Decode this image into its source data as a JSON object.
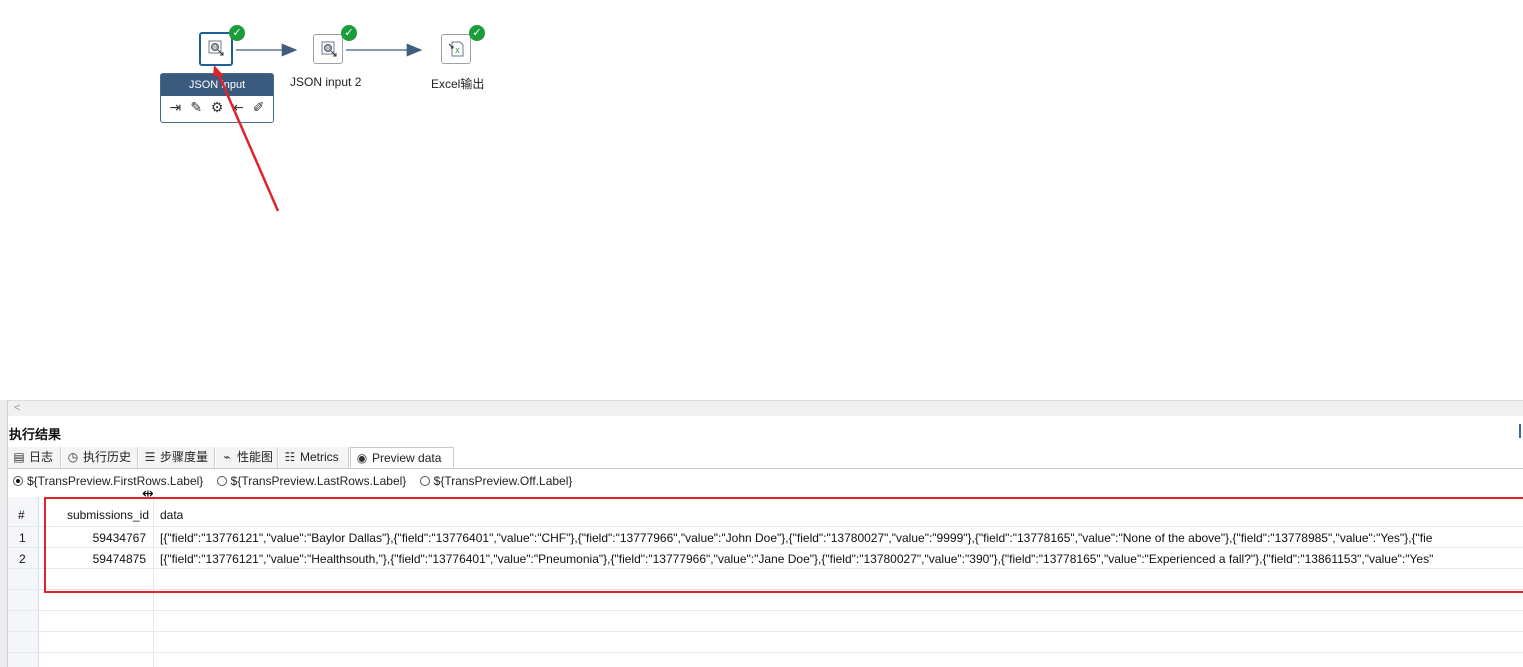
{
  "canvas": {
    "steps": [
      {
        "id": "json-input",
        "label": "JSON input",
        "icon": "json-input-icon",
        "status": "success"
      },
      {
        "id": "json-input-2",
        "label": "JSON input 2",
        "icon": "json-input-icon",
        "status": "success"
      },
      {
        "id": "excel-output",
        "label": "Excel输出",
        "icon": "excel-output-icon",
        "status": "success"
      }
    ],
    "popup": {
      "title": "JSON input",
      "tools": [
        "input-icon",
        "edit-icon",
        "gear-icon",
        "output-icon",
        "pencil-icon"
      ]
    },
    "scroll_left_glyph": "<"
  },
  "results": {
    "title": "执行结果",
    "tabs": [
      {
        "label": "日志",
        "icon": "log-icon"
      },
      {
        "label": "执行历史",
        "icon": "history-icon"
      },
      {
        "label": "步骤度量",
        "icon": "step-metrics-icon"
      },
      {
        "label": "性能图",
        "icon": "performance-chart-icon"
      },
      {
        "label": "Metrics",
        "icon": "metrics-icon"
      },
      {
        "label": "Preview data",
        "icon": "eye-icon",
        "active": true
      }
    ],
    "radios": [
      {
        "label": "${TransPreview.FirstRows.Label}",
        "checked": true
      },
      {
        "label": "${TransPreview.LastRows.Label}",
        "checked": false
      },
      {
        "label": "${TransPreview.Off.Label}",
        "checked": false
      }
    ],
    "table": {
      "headers": [
        "#",
        "submissions_id",
        "data"
      ],
      "rows": [
        [
          "1",
          "59434767",
          "[{\"field\":\"13776121\",\"value\":\"Baylor Dallas\"},{\"field\":\"13776401\",\"value\":\"CHF\"},{\"field\":\"13777966\",\"value\":\"John Doe\"},{\"field\":\"13780027\",\"value\":\"9999\"},{\"field\":\"13778165\",\"value\":\"None of the above\"},{\"field\":\"13778985\",\"value\":\"Yes\"},{\"fie"
        ],
        [
          "2",
          "59474875",
          "[{\"field\":\"13776121\",\"value\":\"Healthsouth,\"},{\"field\":\"13776401\",\"value\":\"Pneumonia\"},{\"field\":\"13777966\",\"value\":\"Jane Doe\"},{\"field\":\"13780027\",\"value\":\"390\"},{\"field\":\"13778165\",\"value\":\"Experienced a fall?\"},{\"field\":\"13861153\",\"value\":\"Yes\""
        ]
      ]
    }
  },
  "colors": {
    "accent": "#1f5f99",
    "success": "#1d9c3a",
    "annotation_red": "#e0242b",
    "popup_header": "#3b5b7e"
  }
}
